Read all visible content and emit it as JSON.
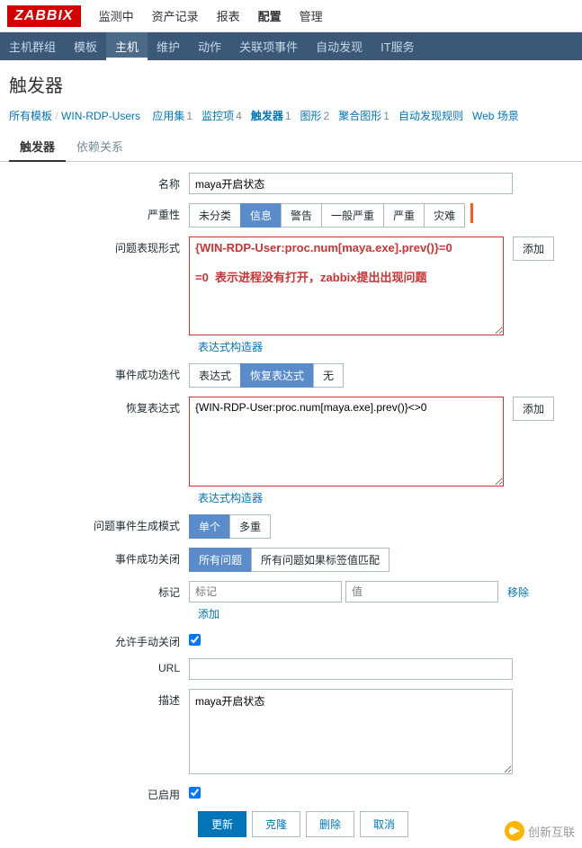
{
  "logo": "ZABBIX",
  "topnav": [
    "监测中",
    "资产记录",
    "报表",
    "配置",
    "管理"
  ],
  "topnav_active": 3,
  "subnav": [
    "主机群组",
    "模板",
    "主机",
    "维护",
    "动作",
    "关联项事件",
    "自动发现",
    "IT服务"
  ],
  "subnav_active": 2,
  "page_title": "触发器",
  "breadcrumb": {
    "all_templates": "所有模板",
    "host": "WIN-RDP-Users",
    "items": [
      {
        "label": "应用集",
        "count": "1"
      },
      {
        "label": "监控项",
        "count": "4"
      },
      {
        "label": "触发器",
        "count": "1",
        "current": true
      },
      {
        "label": "图形",
        "count": "2"
      },
      {
        "label": "聚合图形",
        "count": "1"
      },
      {
        "label": "自动发现规则",
        "count": ""
      },
      {
        "label": "Web 场景",
        "count": ""
      }
    ]
  },
  "tabs": [
    "触发器",
    "依赖关系"
  ],
  "tabs_active": 0,
  "labels": {
    "name": "名称",
    "severity": "严重性",
    "expression": "问题表现形式",
    "expr_builder": "表达式构造器",
    "event_gen": "事件成功迭代",
    "recovery_expr": "恢复表达式",
    "problem_mode": "问题事件生成模式",
    "ok_close": "事件成功关闭",
    "tags": "标记",
    "manual_close": "允许手动关闭",
    "url": "URL",
    "description": "描述",
    "enabled": "已启用"
  },
  "values": {
    "name": "maya开启状态",
    "expression_text": "{WIN-RDP-User:proc.num[maya.exe].prev()}=0\n\n=0  表示进程没有打开，zabbix提出出现问题",
    "recovery_expr": "{WIN-RDP-User:proc.num[maya.exe].prev()}<>0",
    "description": "maya开启状态",
    "url": "",
    "manual_close": true,
    "enabled": true
  },
  "severity_opts": [
    "未分类",
    "信息",
    "警告",
    "一般严重",
    "严重",
    "灾难"
  ],
  "severity_active": 1,
  "event_gen_opts": [
    "表达式",
    "恢复表达式",
    "无"
  ],
  "event_gen_active": 1,
  "problem_mode_opts": [
    "单个",
    "多重"
  ],
  "problem_mode_active": 0,
  "ok_close_opts": [
    "所有问题",
    "所有问题如果标签值匹配"
  ],
  "ok_close_active": 0,
  "tag_placeholders": {
    "name": "标记",
    "value": "值"
  },
  "buttons": {
    "add": "添加",
    "remove": "移除",
    "update": "更新",
    "clone": "克隆",
    "delete": "删除",
    "cancel": "取消"
  },
  "watermark": "创新互联"
}
